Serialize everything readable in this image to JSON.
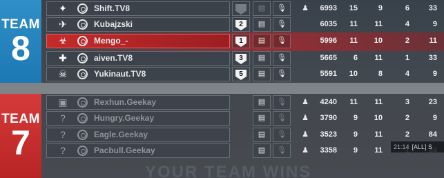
{
  "team8": {
    "label": "TEAM",
    "number": "8",
    "color": "#2f8fc7",
    "players": [
      {
        "name": "Shift.TV8",
        "badge": "",
        "score": "6993",
        "kills": "15",
        "assists": "9",
        "deaths": "6",
        "ping": "33",
        "op_icon": "operator-emblem-icon"
      },
      {
        "name": "Kubajzski",
        "badge": "2",
        "score": "6035",
        "kills": "11",
        "assists": "11",
        "deaths": "4",
        "ping": "9",
        "op_icon": "operator-emblem-icon"
      },
      {
        "name": "Mengo_-",
        "badge": "1",
        "score": "5996",
        "kills": "11",
        "assists": "10",
        "deaths": "2",
        "ping": "11",
        "op_icon": "operator-emblem-icon"
      },
      {
        "name": "aiven.TV8",
        "badge": "3",
        "score": "5665",
        "kills": "6",
        "assists": "11",
        "deaths": "1",
        "ping": "33",
        "op_icon": "operator-emblem-icon"
      },
      {
        "name": "Yukinaut.TV8",
        "badge": "5",
        "score": "5591",
        "kills": "10",
        "assists": "8",
        "deaths": "4",
        "ping": "9",
        "op_icon": "operator-emblem-icon"
      }
    ]
  },
  "team7": {
    "label": "TEAM",
    "number": "7",
    "color": "#d63a3a",
    "players": [
      {
        "name": "Rexhun.Geekay",
        "score": "4240",
        "kills": "11",
        "assists": "11",
        "deaths": "3",
        "ping": "23"
      },
      {
        "name": "Hungry.Geekay",
        "score": "3790",
        "kills": "9",
        "assists": "10",
        "deaths": "2",
        "ping": "9"
      },
      {
        "name": "Eagle.Geekay",
        "score": "3523",
        "kills": "9",
        "assists": "11",
        "deaths": "2",
        "ping": "84"
      },
      {
        "name": "Pacbull.Geekay",
        "score": "3358",
        "kills": "9",
        "assists": "11",
        "deaths": "1",
        "ping": "34"
      }
    ]
  },
  "icons": {
    "chat": "chat-icon",
    "mic": "microphone-icon",
    "hostage": "hostage-icon",
    "uplay": "uplay-logo-icon",
    "unknown_operator": "unknown-operator-icon"
  },
  "chat_overlay": {
    "time": "21:14",
    "text": "[ALL] S"
  },
  "watermark": "YOUR TEAM WINS",
  "highlight_color": "#c42b2b"
}
